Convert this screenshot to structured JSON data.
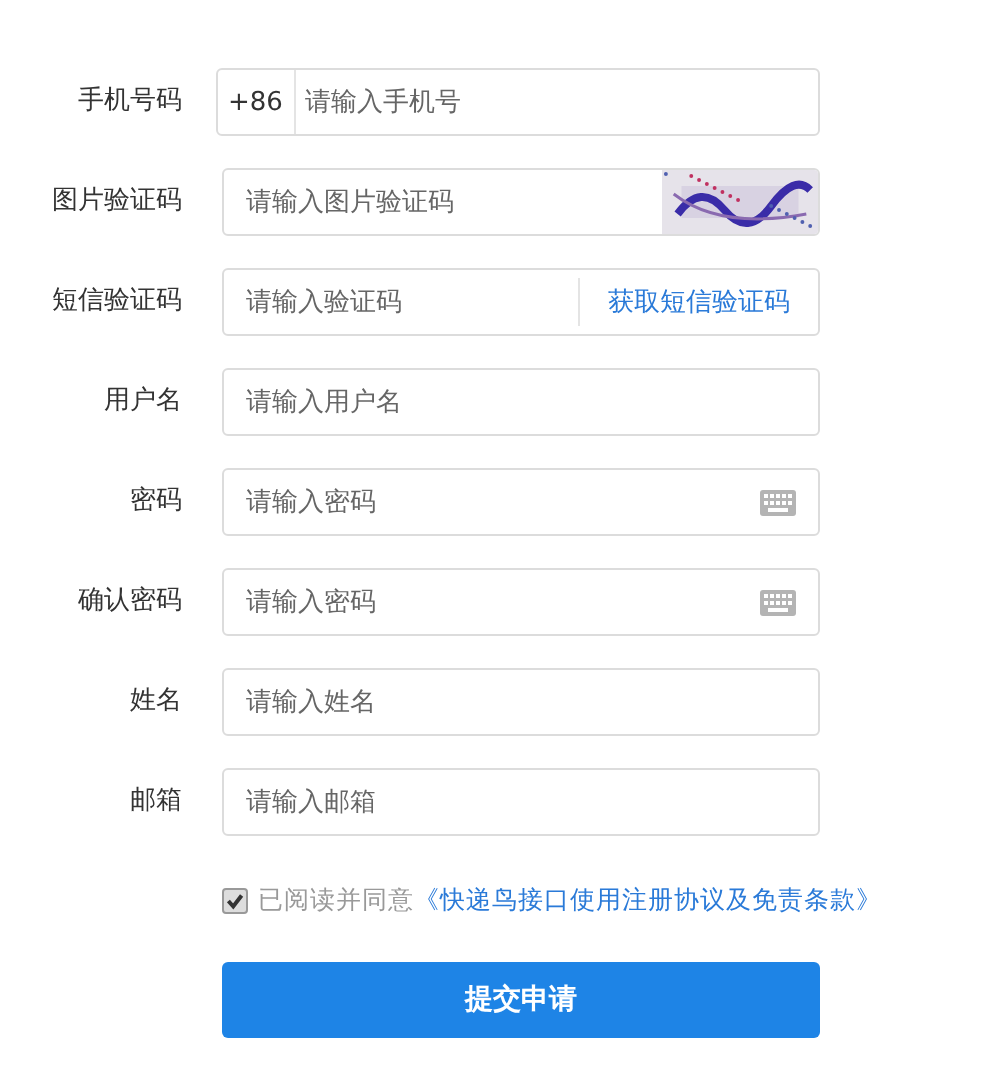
{
  "fields": [
    {
      "kind": "phone",
      "label": "手机号码",
      "prefix": "+86",
      "placeholder": "请输入手机号"
    },
    {
      "kind": "captcha",
      "label": "图片验证码",
      "placeholder": "请输入图片验证码"
    },
    {
      "kind": "sms",
      "label": "短信验证码",
      "placeholder": "请输入验证码",
      "action": "获取短信验证码"
    },
    {
      "kind": "text",
      "label": "用户名",
      "placeholder": "请输入用户名"
    },
    {
      "kind": "password",
      "label": "密码",
      "placeholder": "请输入密码"
    },
    {
      "kind": "password",
      "label": "确认密码",
      "placeholder": "请输入密码"
    },
    {
      "kind": "text",
      "label": "姓名",
      "placeholder": "请输入姓名"
    },
    {
      "kind": "text",
      "label": "邮箱",
      "placeholder": "请输入邮箱"
    }
  ],
  "agreement": {
    "checked": true,
    "text": "已阅读并同意",
    "link": "《快递鸟接口使用注册协议及免责条款》"
  },
  "submit": "提交申请"
}
